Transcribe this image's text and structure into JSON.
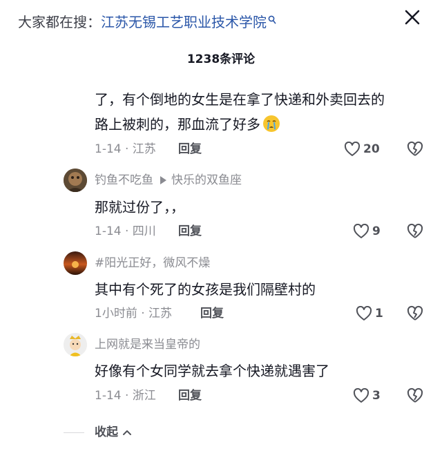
{
  "header": {
    "search_prefix": "大家都在搜：",
    "search_term": "江苏无锡工艺职业技术学院",
    "comment_count": "1238条评论"
  },
  "comments": [
    {
      "lines": [
        "了，有个倒地的女生是在拿了快递和外卖回去的",
        "路上被刺的，那血流了好多"
      ],
      "emoji": "crying-face",
      "meta": "1-14 · 江苏",
      "reply": "回复",
      "likes": "20"
    },
    {
      "username": "钓鱼不吃鱼",
      "reply_to": "快乐的双鱼座",
      "text": "那就过份了，，",
      "meta": "1-14 · 四川",
      "reply": "回复",
      "likes": "9"
    },
    {
      "username": "#阳光正好，微风不燥",
      "text": "其中有个死了的女孩是我们隔壁村的",
      "meta": "1小时前 · 江苏",
      "reply": "回复",
      "likes": "1"
    },
    {
      "username": "上网就是来当皇帝的",
      "text": "好像有个女同学就去拿个快递就遇害了",
      "meta": "1-14 · 浙江",
      "reply": "回复",
      "likes": "3"
    }
  ],
  "footer": {
    "collapse": "收起"
  }
}
